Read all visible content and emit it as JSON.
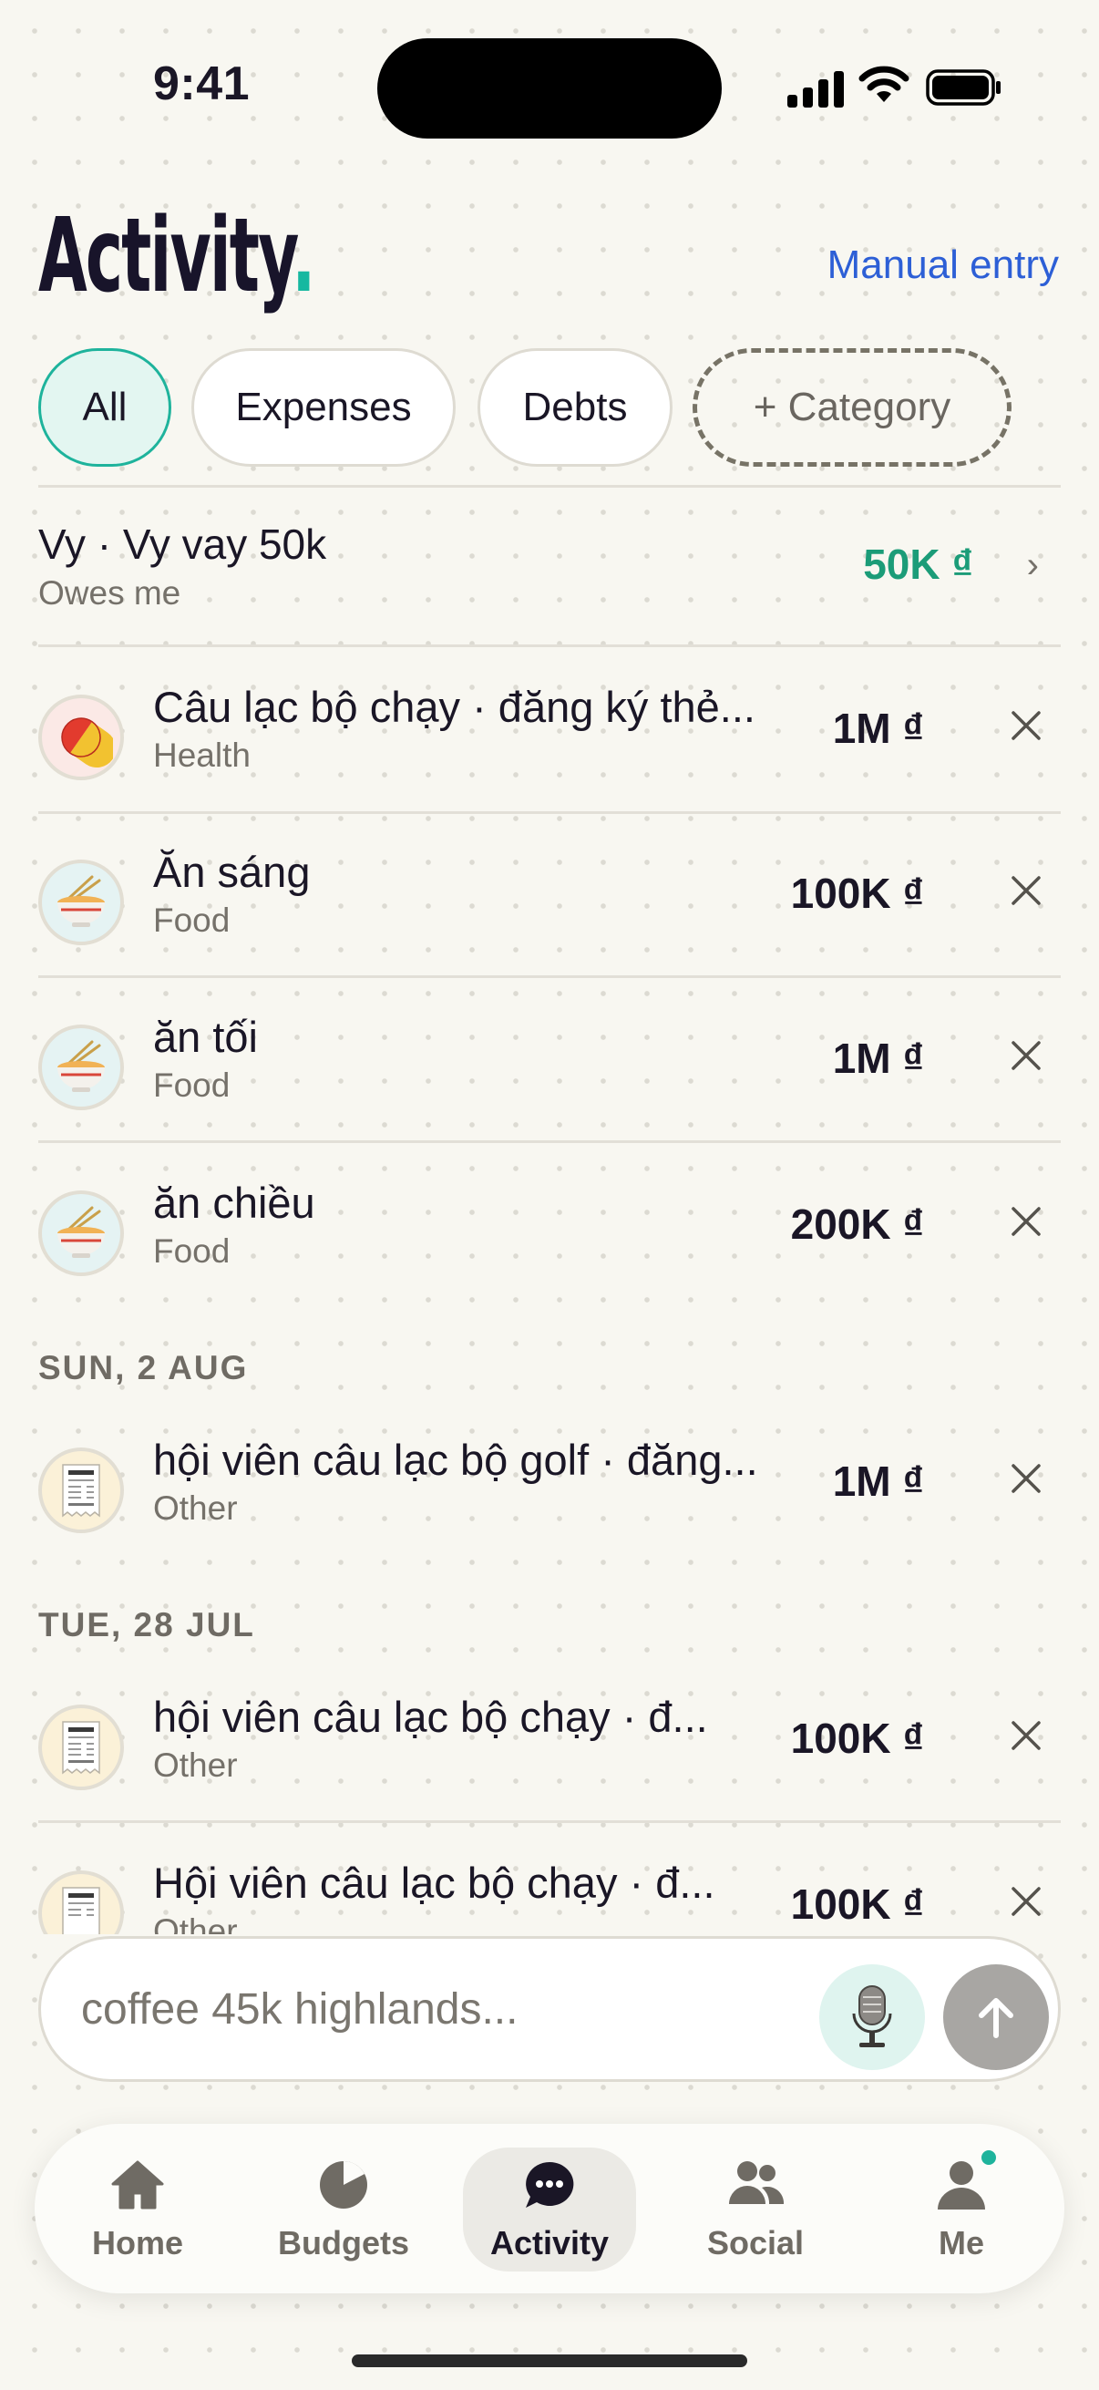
{
  "status_bar": {
    "time": "9:41"
  },
  "header": {
    "title": "Activity",
    "title_dot": ".",
    "manual_entry": "Manual entry"
  },
  "filters": {
    "all": "All",
    "expenses": "Expenses",
    "debts": "Debts",
    "add_category": "+ Category",
    "selected": "All"
  },
  "debt_row": {
    "title": "Vy · Vy vay 50k",
    "subtitle": "Owes me",
    "amount": "50K ₫",
    "chevron": "›"
  },
  "transactions_top": [
    {
      "title": "Câu lạc bộ chạy · đăng ký thẻ...",
      "category": "Health",
      "amount": "1M ₫",
      "icon": "pill-icon"
    },
    {
      "title": "Ăn sáng",
      "category": "Food",
      "amount": "100K ₫",
      "icon": "noodle-bowl-icon"
    },
    {
      "title": "ăn tối",
      "category": "Food",
      "amount": "1M ₫",
      "icon": "noodle-bowl-icon"
    },
    {
      "title": "ăn chiều",
      "category": "Food",
      "amount": "200K ₫",
      "icon": "noodle-bowl-icon"
    }
  ],
  "sections": [
    {
      "label": "SUN, 2 AUG",
      "items": [
        {
          "title": "hội viên câu lạc bộ golf · đăng...",
          "category": "Other",
          "amount": "1M ₫",
          "icon": "receipt-icon"
        }
      ]
    },
    {
      "label": "TUE, 28 JUL",
      "items": [
        {
          "title": "hội viên câu lạc bộ chạy · đ...",
          "category": "Other",
          "amount": "100K ₫",
          "icon": "receipt-icon"
        },
        {
          "title": "Hội viên câu lạc bộ chạy · đ...",
          "category": "Other",
          "amount": "100K ₫",
          "icon": "receipt-icon"
        }
      ]
    }
  ],
  "composer": {
    "placeholder": "coffee 45k highlands..."
  },
  "tabs": [
    {
      "label": "Home",
      "icon": "home-icon"
    },
    {
      "label": "Budgets",
      "icon": "pie-chart-icon"
    },
    {
      "label": "Activity",
      "icon": "chat-bubble-icon"
    },
    {
      "label": "Social",
      "icon": "people-icon"
    },
    {
      "label": "Me",
      "icon": "person-icon"
    }
  ],
  "colors": {
    "accent_teal": "#1eb39c",
    "link_blue": "#2d5fd6",
    "positive_green": "#1b9c78",
    "background": "#f8f7f1"
  }
}
